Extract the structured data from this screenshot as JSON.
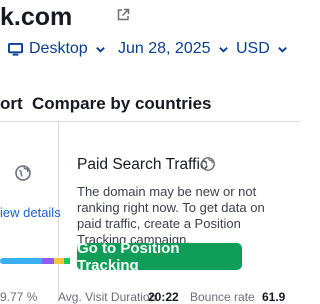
{
  "header": {
    "domain_title": "k.com",
    "external_link_icon": "external-link-icon"
  },
  "toolbar": {
    "device": {
      "label": "Desktop",
      "icon": "monitor-icon"
    },
    "date": {
      "label": "Jun 28, 2025"
    },
    "currency": {
      "label": "USD"
    }
  },
  "tabs": [
    {
      "label": "ort"
    },
    {
      "label": "Compare by countries"
    }
  ],
  "left_panel": {
    "icon": "globe-icon",
    "link": "iew details",
    "bar_colors": [
      "#3ab0f0",
      "#3ab0f0",
      "#8b5cf6",
      "#f5c542",
      "#22c55e"
    ]
  },
  "card": {
    "title": "Paid Search Traffic",
    "title_icon": "globe-icon",
    "description": "The domain may be new or not ranking right now. To get data on paid traffic, create a Position Tracking campaign.",
    "cta": "Go to Position Tracking"
  },
  "bottom_row": {
    "items": [
      "9.77 %",
      "Avg. Visit Duration",
      "20:22",
      "Bounce rate",
      "61.9"
    ]
  },
  "colors": {
    "accent": "#0a3d8f",
    "cta": "#0f9d58",
    "link": "#1f5fd1"
  }
}
